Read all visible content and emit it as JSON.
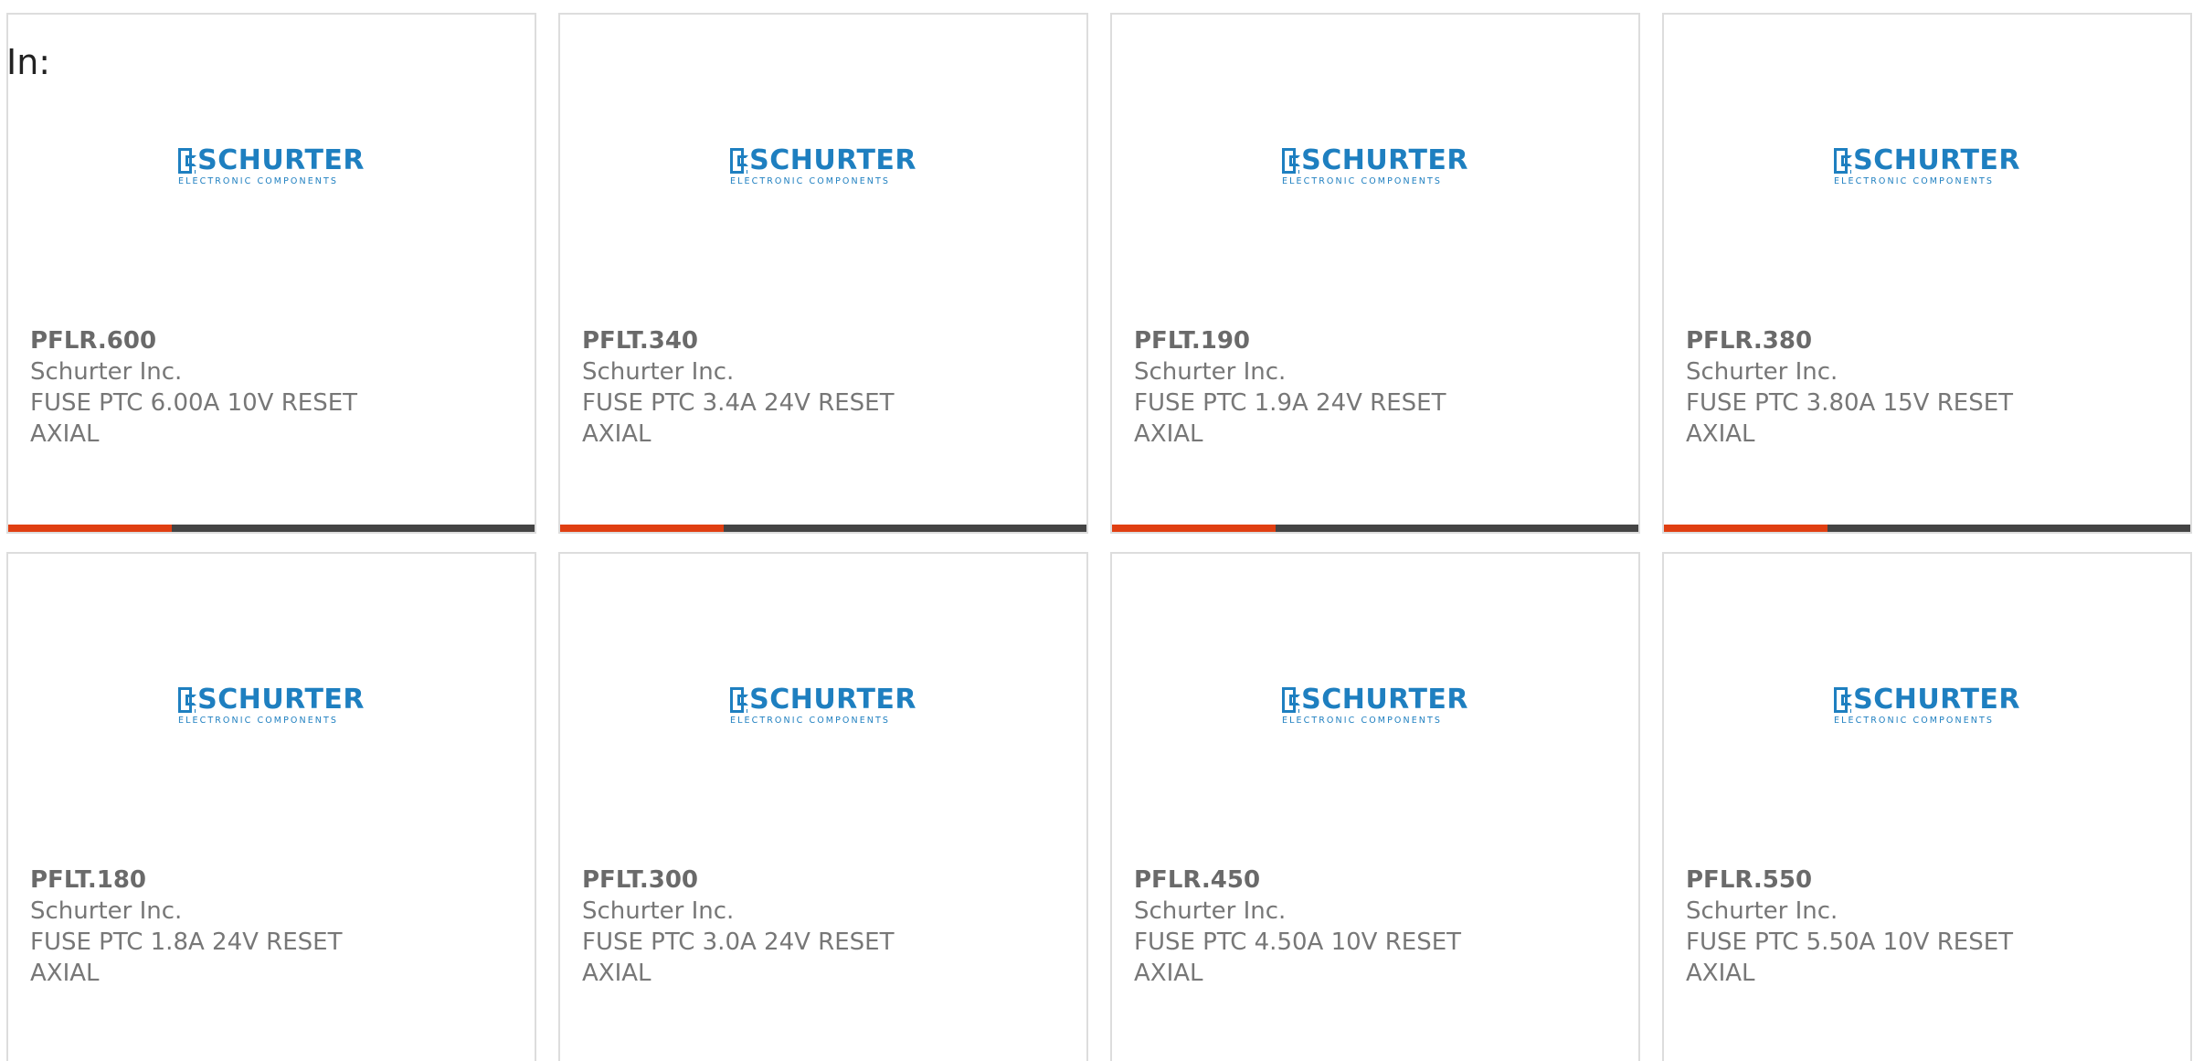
{
  "header": {
    "in_label": "In:"
  },
  "logo": {
    "name": "SCHURTER",
    "tagline": "ELECTRONIC COMPONENTS",
    "brand_color": "#1e7fc0"
  },
  "accent_color": "#e03f12",
  "products": [
    {
      "part": "PFLR.600",
      "maker": "Schurter Inc.",
      "desc": "FUSE PTC 6.00A 10V RESET AXIAL",
      "progress": 0.31
    },
    {
      "part": "PFLT.340",
      "maker": "Schurter Inc.",
      "desc": "FUSE PTC 3.4A 24V RESET AXIAL",
      "progress": 0.31
    },
    {
      "part": "PFLT.190",
      "maker": "Schurter Inc.",
      "desc": "FUSE PTC 1.9A 24V RESET AXIAL",
      "progress": 0.31
    },
    {
      "part": "PFLR.380",
      "maker": "Schurter Inc.",
      "desc": "FUSE PTC 3.80A 15V RESET AXIAL",
      "progress": 0.31
    },
    {
      "part": "PFLT.180",
      "maker": "Schurter Inc.",
      "desc": "FUSE PTC 1.8A 24V RESET AXIAL"
    },
    {
      "part": "PFLT.300",
      "maker": "Schurter Inc.",
      "desc": "FUSE PTC 3.0A 24V RESET AXIAL"
    },
    {
      "part": "PFLR.450",
      "maker": "Schurter Inc.",
      "desc": "FUSE PTC 4.50A 10V RESET AXIAL"
    },
    {
      "part": "PFLR.550",
      "maker": "Schurter Inc.",
      "desc": "FUSE PTC 5.50A 10V RESET AXIAL"
    }
  ]
}
